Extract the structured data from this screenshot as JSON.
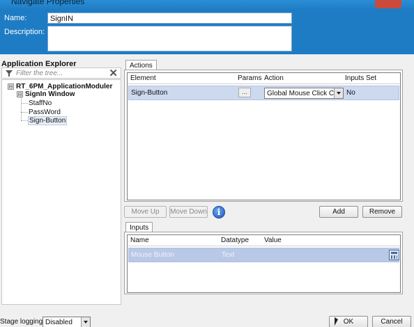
{
  "window": {
    "title": "Navigate Properties"
  },
  "header": {
    "name_label": "Name:",
    "name_value": "SignIN",
    "description_label": "Description:",
    "description_value": ""
  },
  "explorer": {
    "title": "Application Explorer",
    "filter_placeholder": "Filter the tree...",
    "tree": [
      {
        "label": "RT_6PM_ApplicationModuler",
        "expander": "⊟"
      },
      {
        "label": "SignIn Window",
        "expander": "⊟"
      },
      {
        "label": "StaffNo"
      },
      {
        "label": "PassWord"
      },
      {
        "label": "Sign-Button"
      }
    ]
  },
  "actions": {
    "tab_label": "Actions",
    "columns": [
      "Element",
      "Params",
      "Action",
      "Inputs Set"
    ],
    "rows": [
      {
        "element": "Sign-Button",
        "params": "...",
        "action": "Global Mouse Click Cen",
        "inputs_set": "No"
      }
    ],
    "buttons": {
      "move_up": "Move Up",
      "move_down": "Move Down",
      "info": "i",
      "add": "Add",
      "remove": "Remove"
    }
  },
  "inputs": {
    "tab_label": "Inputs",
    "columns": [
      "Name",
      "Datatype",
      "Value"
    ],
    "rows": [
      {
        "name": "Mouse Button",
        "datatype": "Text",
        "value": ""
      }
    ]
  },
  "footer": {
    "stage_logging_label": "Stage logging:",
    "stage_logging_value": "Disabled",
    "ok": "OK",
    "cancel": "Cancel"
  }
}
